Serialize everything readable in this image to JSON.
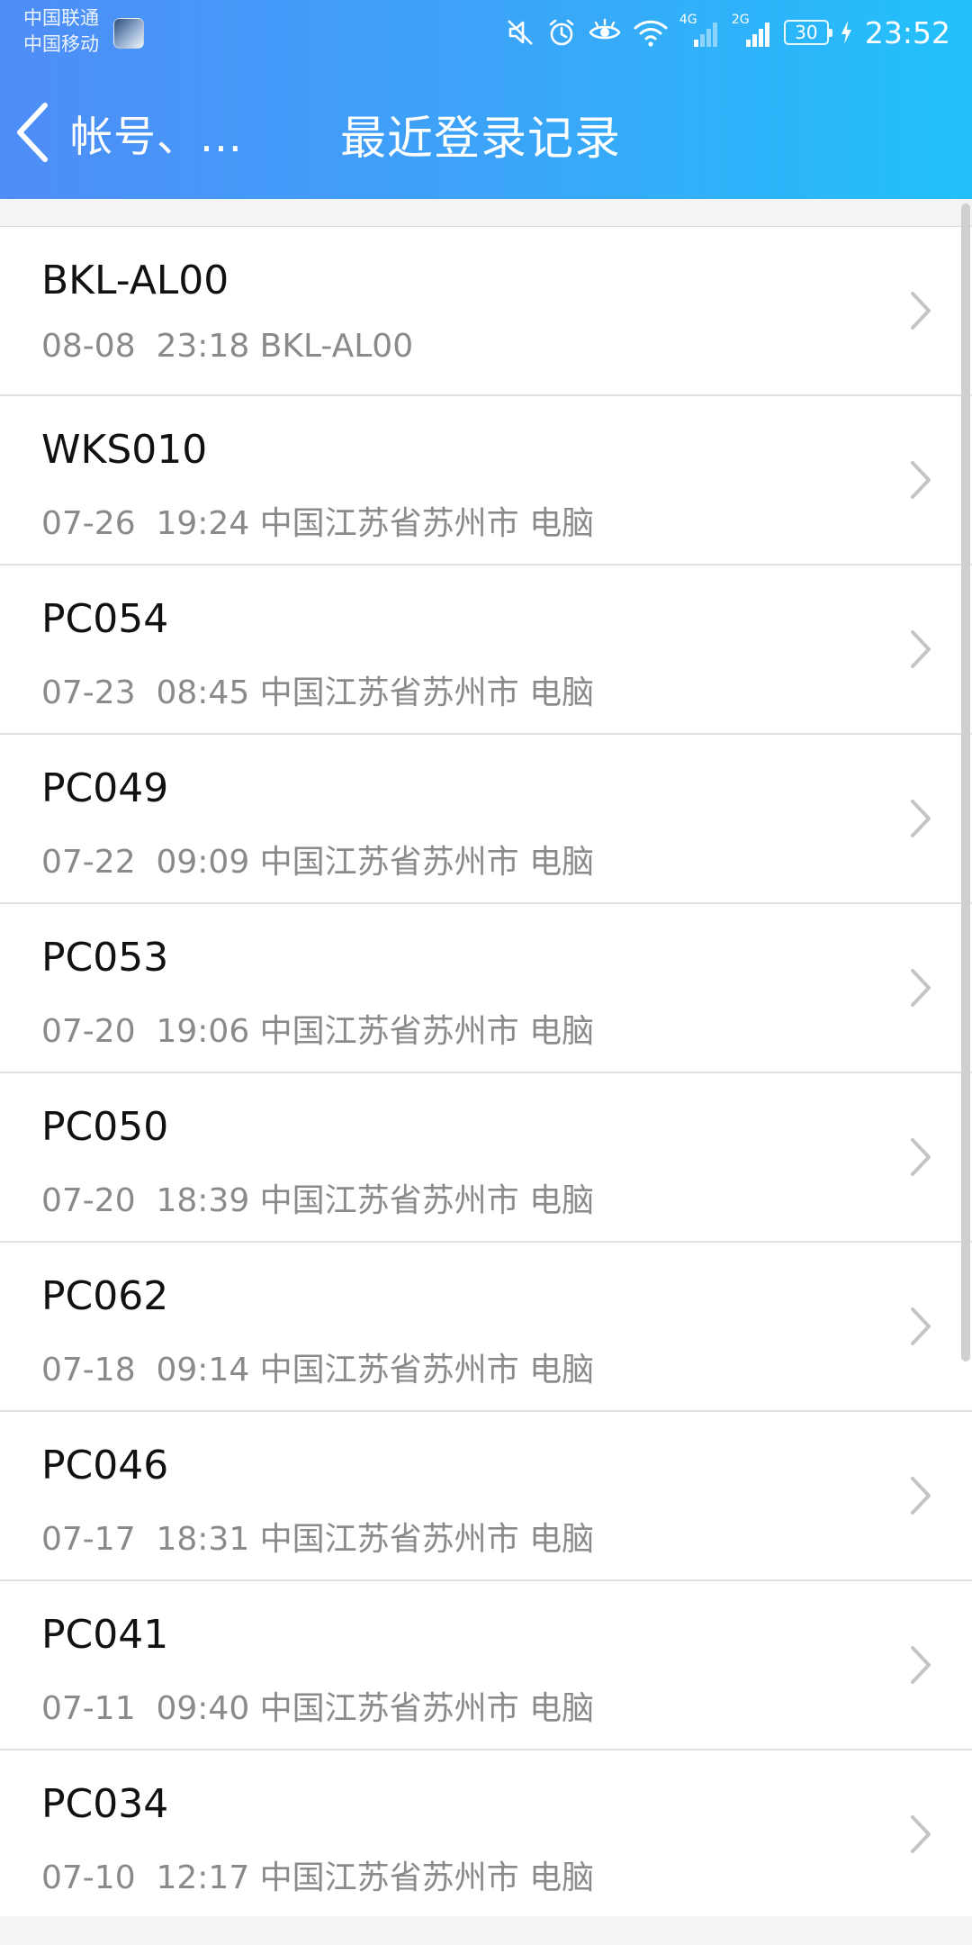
{
  "status_bar": {
    "carrier_1": "中国联通",
    "carrier_2": "中国移动",
    "network_1": "4G",
    "network_2": "2G",
    "battery": "30",
    "time": "23:52"
  },
  "header": {
    "back_label": "帐号、...",
    "title": "最近登录记录"
  },
  "records": [
    {
      "device": "BKL-AL00",
      "detail": "08-08  23:18 BKL-AL00"
    },
    {
      "device": "WKS010",
      "detail": "07-26  19:24 中国江苏省苏州市 电脑"
    },
    {
      "device": "PC054",
      "detail": "07-23  08:45 中国江苏省苏州市 电脑"
    },
    {
      "device": "PC049",
      "detail": "07-22  09:09 中国江苏省苏州市 电脑"
    },
    {
      "device": "PC053",
      "detail": "07-20  19:06 中国江苏省苏州市 电脑"
    },
    {
      "device": "PC050",
      "detail": "07-20  18:39 中国江苏省苏州市 电脑"
    },
    {
      "device": "PC062",
      "detail": "07-18  09:14 中国江苏省苏州市 电脑"
    },
    {
      "device": "PC046",
      "detail": "07-17  18:31 中国江苏省苏州市 电脑"
    },
    {
      "device": "PC041",
      "detail": "07-11  09:40 中国江苏省苏州市 电脑"
    },
    {
      "device": "PC034",
      "detail": "07-10  12:17 中国江苏省苏州市 电脑"
    }
  ]
}
